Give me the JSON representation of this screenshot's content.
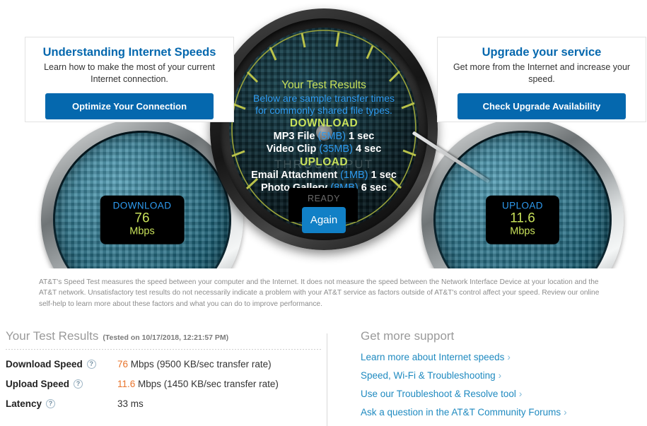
{
  "promo_cards": [
    {
      "title": "Understanding Internet Speeds",
      "description": "Learn how to make the most of your current Internet connection.",
      "button": "Optimize Your Connection"
    },
    {
      "title": "Upgrade your service",
      "description": "Get more from the Internet and increase your speed.",
      "button": "Check Upgrade Availability"
    }
  ],
  "gauges": {
    "download": {
      "label": "DOWNLOAD",
      "value": "76",
      "unit": "Mbps"
    },
    "upload": {
      "label": "UPLOAD",
      "value": "11.6",
      "unit": "Mbps"
    },
    "center": {
      "watermark": "THROUGHPUT",
      "title": "Your Test Results",
      "subtitle_line1": "Below are sample transfer times",
      "subtitle_line2": "for commonly shared file types.",
      "download_heading": "DOWNLOAD",
      "upload_heading": "UPLOAD",
      "download_rows": [
        {
          "name": "MP3 File",
          "size": "(5MB)",
          "time": "1 sec"
        },
        {
          "name": "Video Clip",
          "size": "(35MB)",
          "time": "4 sec"
        }
      ],
      "upload_rows": [
        {
          "name": "Email Attachment",
          "size": "(1MB)",
          "time": "1 sec"
        },
        {
          "name": "Photo Gallery",
          "size": "(8MB)",
          "time": "6 sec"
        }
      ],
      "status": "READY",
      "again_button": "Again"
    }
  },
  "disclaimer": "AT&T's Speed Test measures the speed between your computer and the Internet. It does not measure the speed between the Network Interface Device at your location and the AT&T network. Unsatisfactory test results do not necessarily indicate a problem with your AT&T service as factors outside of AT&T's control affect your speed. Review our online self-help to learn more about these factors and what you can do to improve performance.",
  "results": {
    "title": "Your Test Results",
    "tested_on": "(Tested on 10/17/2018, 12:21:57 PM)",
    "help_glyph": "?",
    "rows": [
      {
        "label": "Download Speed",
        "number": "76",
        "rest": " Mbps (9500 KB/sec transfer rate)",
        "has_help": true
      },
      {
        "label": "Upload Speed",
        "number": "11.6",
        "rest": " Mbps (1450 KB/sec transfer rate)",
        "has_help": true
      },
      {
        "label": "Latency",
        "number": "",
        "rest": "33 ms",
        "has_help": true
      }
    ]
  },
  "support": {
    "title": "Get more support",
    "chevron": "›",
    "links": [
      "Learn more about Internet speeds",
      "Speed, Wi-Fi & Troubleshooting",
      "Use our Troubleshoot & Resolve tool",
      "Ask a question in the AT&T Community Forums"
    ]
  },
  "colors": {
    "brand_blue": "#0568ae",
    "accent_green": "#c7e05a",
    "accent_cyan": "#2e9bf0",
    "orange": "#e8732a",
    "link_blue": "#1f8ac0"
  }
}
